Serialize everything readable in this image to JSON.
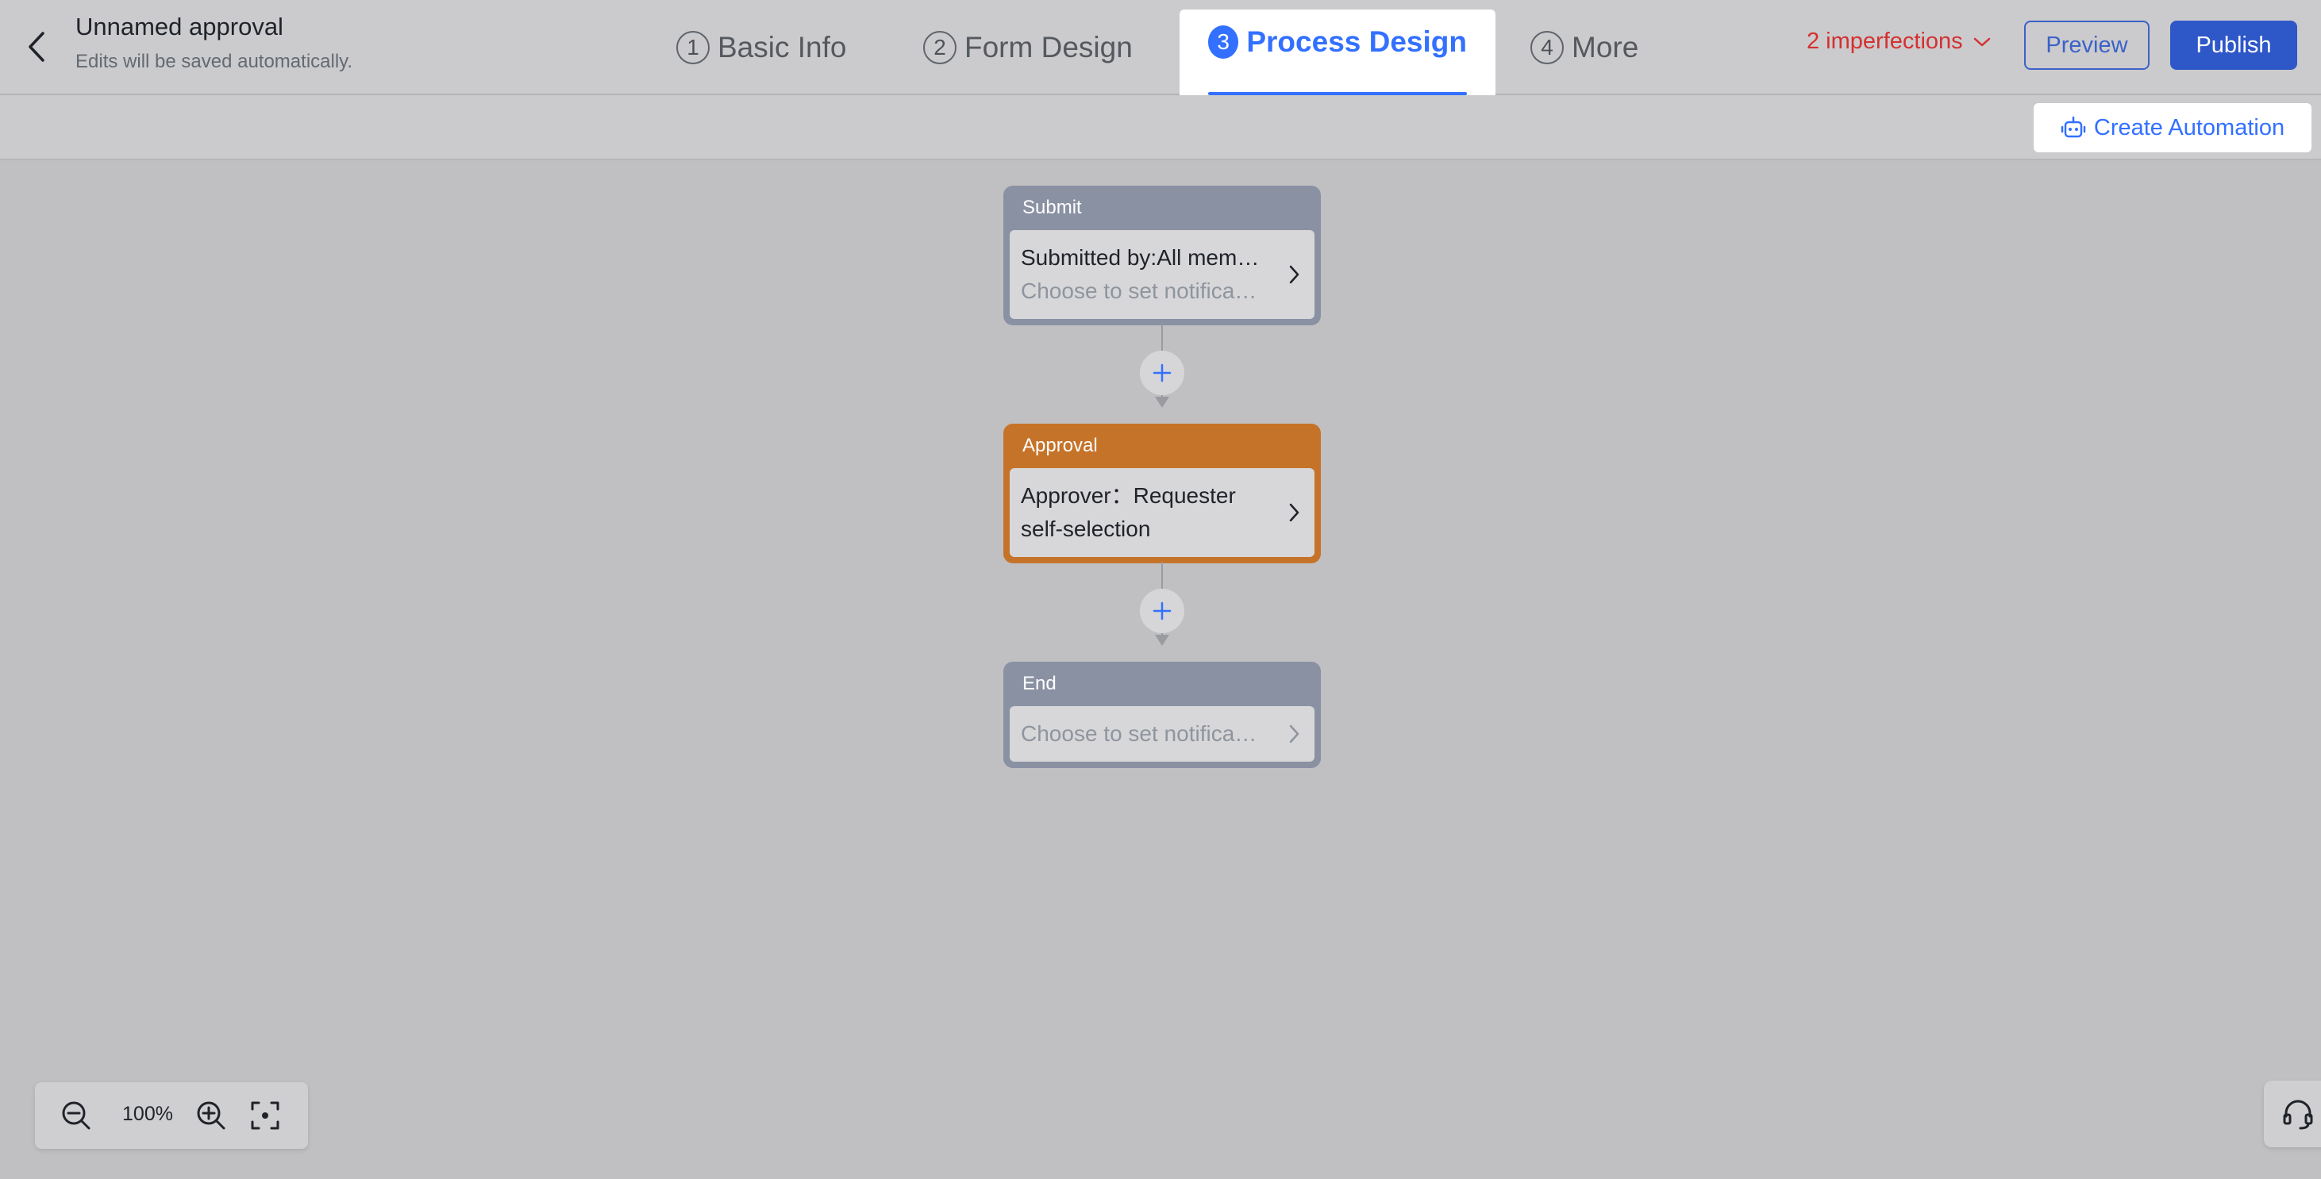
{
  "header": {
    "title": "Unnamed approval",
    "subtitle": "Edits will be saved automatically.",
    "steps": [
      {
        "number": "1",
        "label": "Basic Info",
        "active": false
      },
      {
        "number": "2",
        "label": "Form Design",
        "active": false
      },
      {
        "number": "3",
        "label": "Process Design",
        "active": true
      },
      {
        "number": "4",
        "label": "More",
        "active": false
      }
    ],
    "imperfections": "2 imperfections",
    "preview_label": "Preview",
    "publish_label": "Publish"
  },
  "toolbar": {
    "create_automation_label": "Create Automation",
    "automation_icon": "robot-icon"
  },
  "flow": {
    "submit": {
      "title": "Submit",
      "line1": "Submitted by:All mem…",
      "line2": "Choose to set notifica…"
    },
    "approval": {
      "title": "Approval",
      "line1": "Approver：Requester self-selection"
    },
    "end": {
      "title": "End",
      "line1": "Choose to set notifica…"
    }
  },
  "zoom": {
    "level": "100%"
  },
  "colors": {
    "accent": "#3370ff",
    "publish": "#2e57c8",
    "error": "#d43030",
    "submit_node": "#8a91a3",
    "approval_node": "#c6732a",
    "end_node": "#8a91a3",
    "canvas": "#c0c0c2"
  }
}
